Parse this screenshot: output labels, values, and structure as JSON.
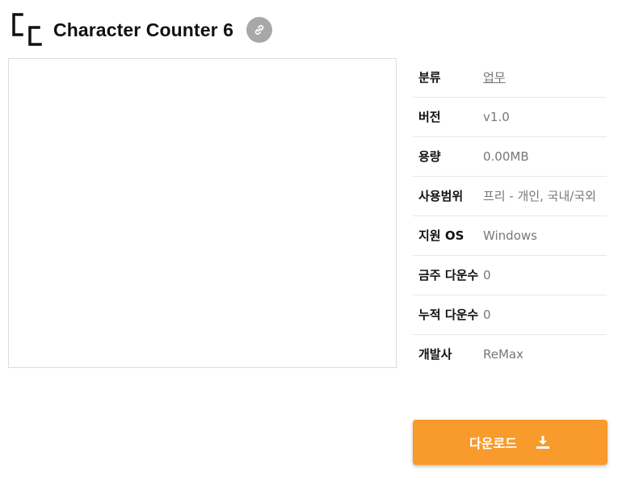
{
  "header": {
    "title": "Character Counter 6",
    "logo_icon": "cc-logo-icon",
    "link_icon": "link-icon"
  },
  "info": {
    "rows": [
      {
        "label": "분류",
        "value": "업무",
        "is_link": true
      },
      {
        "label": "버전",
        "value": "v1.0"
      },
      {
        "label": "용량",
        "value": "0.00MB"
      },
      {
        "label": "사용범위",
        "value": "프리 - 개인, 국내/국외"
      },
      {
        "label": "지원 OS",
        "value": "Windows"
      },
      {
        "label": "금주 다운수",
        "value": "0"
      },
      {
        "label": "누적 다운수",
        "value": "0"
      },
      {
        "label": "개발사",
        "value": "ReMax"
      }
    ]
  },
  "download": {
    "label": "다운로드",
    "icon": "download-icon"
  },
  "colors": {
    "accent": "#f89a2c",
    "link_button_bg": "#a8a8a8",
    "value_text": "#777777"
  }
}
